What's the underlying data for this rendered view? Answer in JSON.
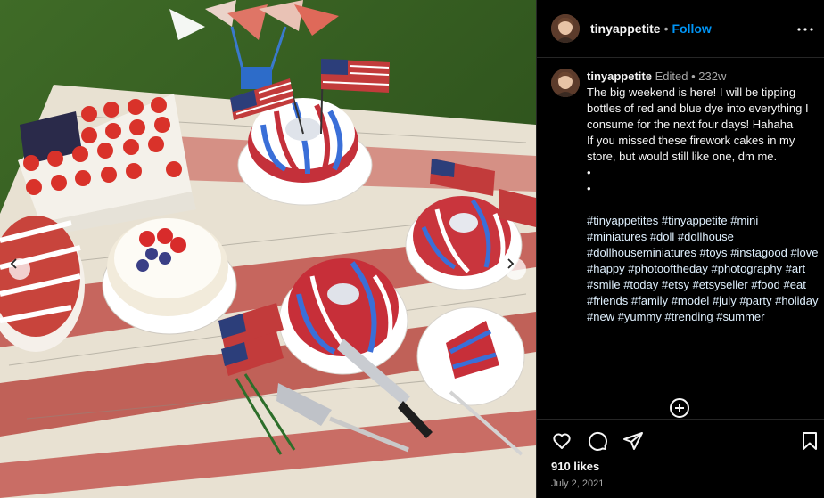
{
  "post": {
    "username": "tinyappetite",
    "follow_label": "Follow",
    "header_separator": "•",
    "caption": {
      "edited_label": "Edited",
      "separator": "•",
      "age": "232w",
      "lines": [
        "The big weekend is here! I will be tipping bottles of red and blue dye into everything I consume for the next four days! Hahaha",
        "If you missed these firework cakes in my store, but would still like one, dm me.",
        "•",
        "•"
      ],
      "hashtags": [
        "#tinyappetites",
        "#tinyappetite",
        "#mini",
        "#miniatures",
        "#doll",
        "#dollhouse",
        "#dollhouseminiatures",
        "#toys",
        "#instagood",
        "#love",
        "#happy",
        "#photooftheday",
        "#photography",
        "#art",
        "#smile",
        "#today",
        "#etsy",
        "#etsyseller",
        "#food",
        "#eat",
        "#friends",
        "#family",
        "#model",
        "#july",
        "#party",
        "#holiday",
        "#new",
        "#yummy",
        "#trending",
        "#summer"
      ]
    },
    "likes": "910 likes",
    "date": "July 2, 2021"
  },
  "icons": {
    "more": "more-horizontal-icon",
    "add_comment": "plus-circle-icon",
    "like": "heart-icon",
    "comment": "comment-bubble-icon",
    "share": "paper-plane-icon",
    "save": "bookmark-icon",
    "prev": "chevron-left-icon",
    "next": "chevron-right-icon"
  },
  "colors": {
    "background": "#000000",
    "text": "#f5f5f5",
    "muted": "#a8a8a8",
    "link": "#0095f6",
    "hashtag": "#e0f1ff",
    "border": "#262626"
  }
}
